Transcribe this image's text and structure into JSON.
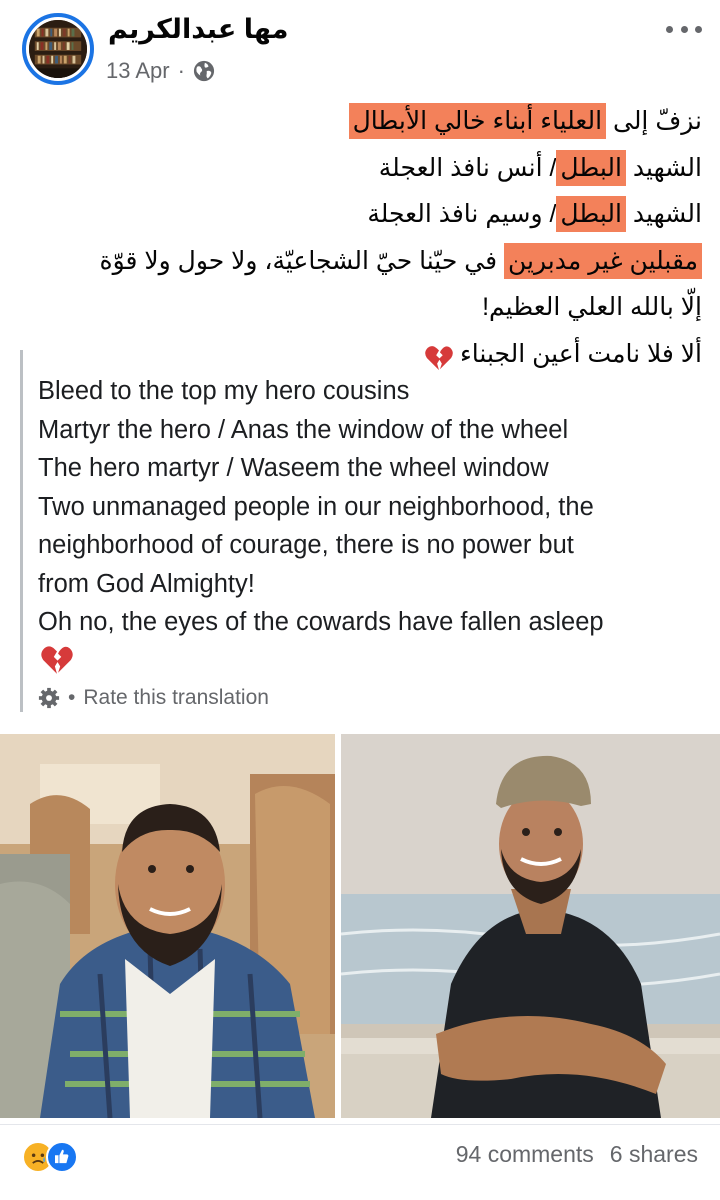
{
  "post": {
    "author": "مها عبدالكريم",
    "date": "13 Apr",
    "separator": "·",
    "privacy_icon": "globe-icon",
    "more_icon": "more-icon"
  },
  "arabic_text": {
    "line1_hl": "العلياء أبناء خالي الأبطال",
    "line1_pre": "نزفّ إلى ",
    "line2_pre": "الشهيد ",
    "line2_hl": "البطل",
    "line2_post": "/ أنس نافذ العجلة",
    "line3_pre": "الشهيد ",
    "line3_hl": "البطل",
    "line3_post": "/ وسيم نافذ العجلة",
    "line4_hl": "مقبلين غير مدبرين",
    "line4_post": " في حيّنا حيّ الشجاعيّة، ولا حول ولا قوّة",
    "line5": "إلّا بالله العلي العظيم!",
    "line6": "ألا فلا نامت أعين الجبناء",
    "emoji": "broken-heart-icon"
  },
  "translation": {
    "lines": [
      "Bleed to the top my hero cousins",
      "Martyr the hero / Anas the window of the wheel",
      "The hero martyr / Waseem the wheel window",
      "Two unmanaged people in our neighborhood, the",
      "neighborhood of courage, there is no power but",
      "from God Almighty!",
      "Oh no, the eyes of the cowards have fallen asleep"
    ],
    "emoji": "broken-heart-icon",
    "rate_label": "Rate this translation",
    "rate_separator": "•"
  },
  "footer": {
    "reactions": [
      "sad",
      "like"
    ],
    "comments": "94 comments",
    "shares": "6 shares"
  },
  "colors": {
    "highlight": "#f3815a",
    "avatar_ring": "#1b74e4",
    "secondary_text": "#65676b"
  }
}
